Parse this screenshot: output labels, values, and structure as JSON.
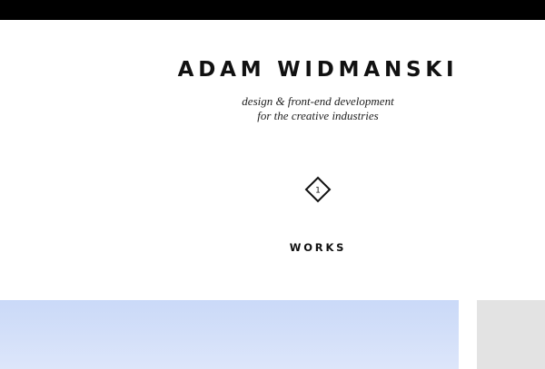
{
  "header": {
    "title": "ADAM WIDMANSKI",
    "tagline_line1": "design & front-end development",
    "tagline_line2": "for the creative industries"
  },
  "section": {
    "number": "1",
    "title": "WORKS"
  },
  "works": [
    {
      "thumbnail": "sky-photo"
    },
    {
      "thumbnail": "gray-placeholder"
    }
  ],
  "colors": {
    "top_bar": "#000000",
    "background": "#ffffff",
    "text": "#111111",
    "tile_sky": "#cad9f8",
    "tile_gray": "#e3e3e3"
  }
}
